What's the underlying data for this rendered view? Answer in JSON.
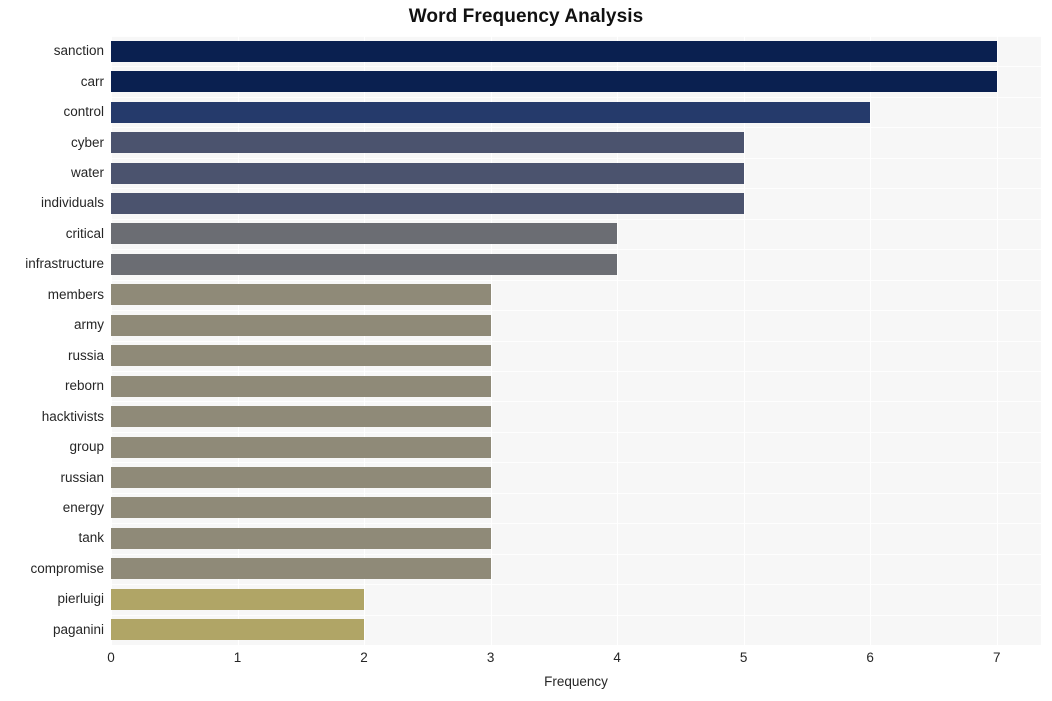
{
  "chart_data": {
    "type": "bar",
    "orientation": "horizontal",
    "title": "Word Frequency Analysis",
    "xlabel": "Frequency",
    "ylabel": "",
    "categories": [
      "sanction",
      "carr",
      "control",
      "cyber",
      "water",
      "individuals",
      "critical",
      "infrastructure",
      "members",
      "army",
      "russia",
      "reborn",
      "hacktivists",
      "group",
      "russian",
      "energy",
      "tank",
      "compromise",
      "pierluigi",
      "paganini"
    ],
    "values": [
      7,
      7,
      6,
      5,
      5,
      5,
      4,
      4,
      3,
      3,
      3,
      3,
      3,
      3,
      3,
      3,
      3,
      3,
      2,
      2
    ],
    "bar_colors": [
      "#0a2050",
      "#0a2050",
      "#253a6b",
      "#4b536e",
      "#4b536e",
      "#4b536e",
      "#6b6d73",
      "#6b6d73",
      "#8f8a78",
      "#8f8a78",
      "#8f8a78",
      "#8f8a78",
      "#8f8a78",
      "#8f8a78",
      "#8f8a78",
      "#8f8a78",
      "#8f8a78",
      "#8f8a78",
      "#b0a566",
      "#b0a566"
    ],
    "xlim": [
      0,
      7.35
    ],
    "xticks": [
      0,
      1,
      2,
      3,
      4,
      5,
      6,
      7
    ],
    "xtick_labels": [
      "0",
      "1",
      "2",
      "3",
      "4",
      "5",
      "6",
      "7"
    ],
    "grid": true,
    "grid_color": "#ffffff",
    "plot_background": "#f7f7f7",
    "figure_background": "#ffffff",
    "legend": null
  }
}
